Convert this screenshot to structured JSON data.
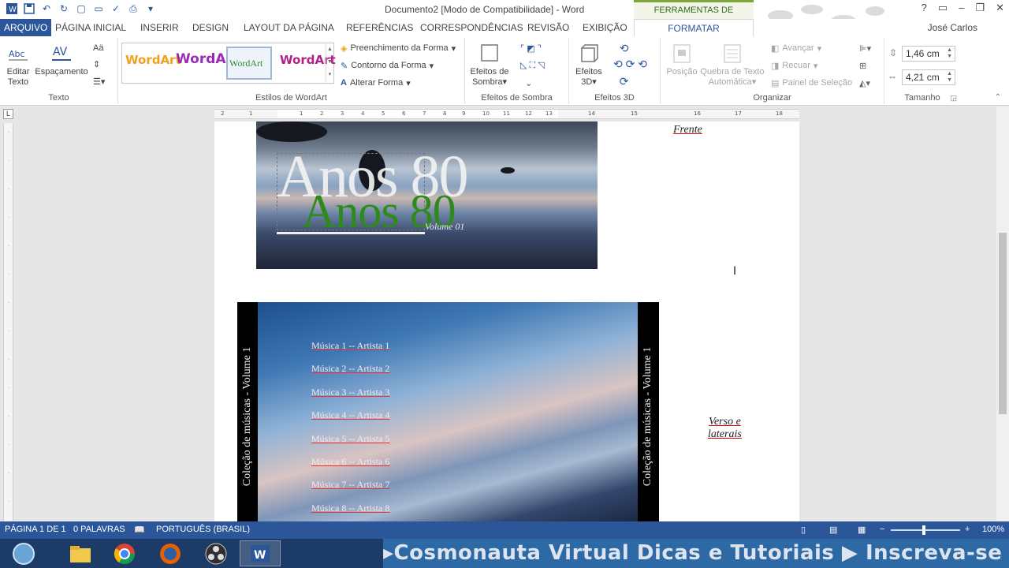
{
  "title_bar": {
    "document_title": "Documento2 [Modo de Compatibilidade] - Word",
    "context_label": "FERRAMENTAS DE WORDART",
    "window_buttons": [
      "?",
      "▭",
      "–",
      "❐",
      "✕"
    ]
  },
  "tabs": {
    "arquivo": "ARQUIVO",
    "pagina_inicial": "PÁGINA INICIAL",
    "inserir": "INSERIR",
    "design": "DESIGN",
    "layout": "LAYOUT DA PÁGINA",
    "referencias": "REFERÊNCIAS",
    "correspondencias": "CORRESPONDÊNCIAS",
    "revisao": "REVISÃO",
    "exibicao": "EXIBIÇÃO",
    "formatar": "FORMATAR",
    "user": "José Carlos"
  },
  "ribbon": {
    "texto": {
      "editar_texto": "Editar Texto",
      "espacamento": "Espaçamento",
      "group_label": "Texto"
    },
    "estilos": {
      "samples": [
        "WordArt",
        "WordArt",
        "WordArt",
        "WordArt"
      ],
      "preenchimento": "Preenchimento da Forma",
      "contorno": "Contorno da Forma",
      "alterar": "Alterar Forma",
      "group_label": "Estilos de WordArt"
    },
    "sombra": {
      "efeitos_sombra": "Efeitos de Sombra",
      "group_label": "Efeitos de Sombra"
    },
    "efeitos3d": {
      "efeitos_3d": "Efeitos 3D",
      "group_label": "Efeitos 3D"
    },
    "organizar": {
      "posicao": "Posição",
      "quebra": "Quebra de Texto Automática",
      "avancar": "Avançar",
      "recuar": "Recuar",
      "painel": "Painel de Seleção",
      "group_label": "Organizar"
    },
    "tamanho": {
      "altura": "1,46 cm",
      "largura": "4,21 cm",
      "group_label": "Tamanho"
    }
  },
  "ruler": {
    "corner": "L",
    "ticks": [
      "2",
      "1",
      "1",
      "2",
      "3",
      "4",
      "5",
      "6",
      "7",
      "8",
      "9",
      "10",
      "11",
      "12",
      "13",
      "14",
      "15",
      "16",
      "17",
      "18"
    ]
  },
  "document": {
    "wordart_main": "Anos 80",
    "wordart_shadow": "Anos 80",
    "volume": "Volume 01",
    "frente": "Frente",
    "spine_left": "Coleção de músicas  -  Volume 1",
    "spine_right": "Coleção de músicas  -  Volume 1",
    "tracks": [
      "Música 1 -- Artista 1",
      "Música 2 -- Artista 2",
      "Música 3 -- Artista 3",
      "Música 4 -- Artista 4",
      "Música 5 -- Artista 5",
      "Música 6 -- Artista 6",
      "Música 7 -- Artista 7",
      "Música 8 -- Artista 8"
    ],
    "verso_line1": "Verso e",
    "verso_line2": "laterais"
  },
  "status_bar": {
    "page": "PÁGINA 1 DE 1",
    "words": "0 PALAVRAS",
    "language": "PORTUGUÊS (BRASIL)",
    "zoom": "100%"
  },
  "taskbar": {
    "banner": "▸Cosmonauta Virtual Dicas e Tutoriais ▶ Inscreva-se"
  }
}
